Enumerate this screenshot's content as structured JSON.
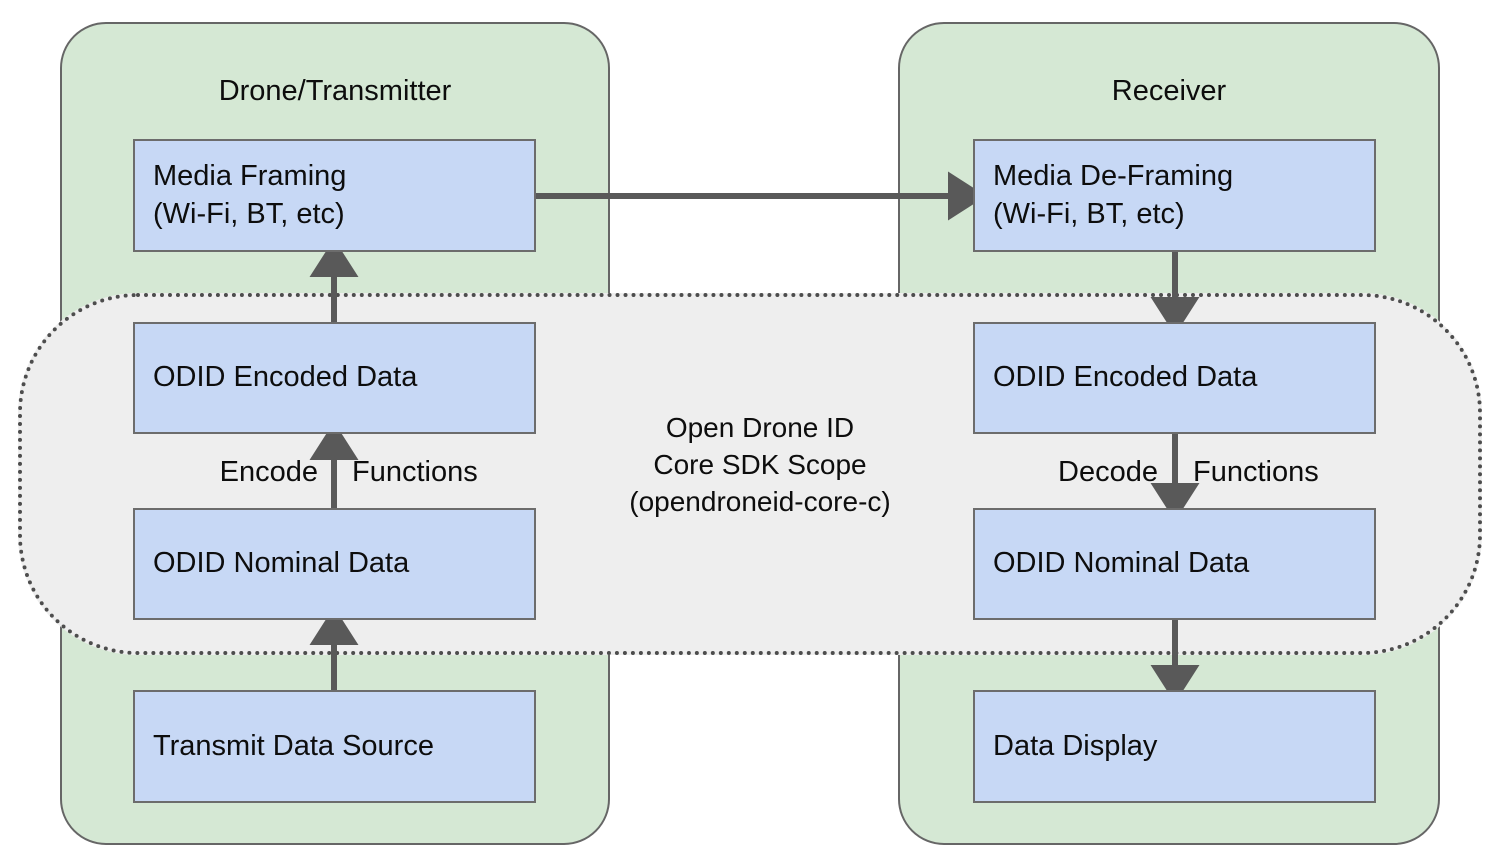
{
  "diagram": {
    "title": "Open Drone ID Core SDK Scope",
    "colors": {
      "panel_fill": "#d5e8d4",
      "panel_stroke": "#666666",
      "box_fill": "#c7d8f5",
      "box_stroke": "#6c6c6c",
      "scope_fill": "#eeeeee",
      "scope_stroke": "#4d4d4d",
      "arrow": "#595959",
      "text": "#0d0d0d",
      "background": "#ffffff"
    }
  },
  "panels": {
    "transmitter": {
      "title": "Drone/Transmitter"
    },
    "receiver": {
      "title": "Receiver"
    }
  },
  "scope": {
    "line1": "Open Drone ID",
    "line2": "Core SDK Scope",
    "line3": "(opendroneid-core-c)"
  },
  "transmit_chain": {
    "media_framing": "Media Framing\n(Wi-Fi, BT, etc)",
    "odid_encoded": "ODID Encoded Data",
    "odid_nominal": "ODID Nominal Data",
    "data_source": "Transmit Data Source",
    "encode_label_left": "Encode",
    "encode_label_right": "Functions"
  },
  "receive_chain": {
    "media_deframing": "Media De-Framing\n(Wi-Fi, BT, etc)",
    "odid_encoded": "ODID Encoded Data",
    "odid_nominal": "ODID Nominal Data",
    "data_display": "Data Display",
    "decode_label_left": "Decode",
    "decode_label_right": "Functions"
  }
}
